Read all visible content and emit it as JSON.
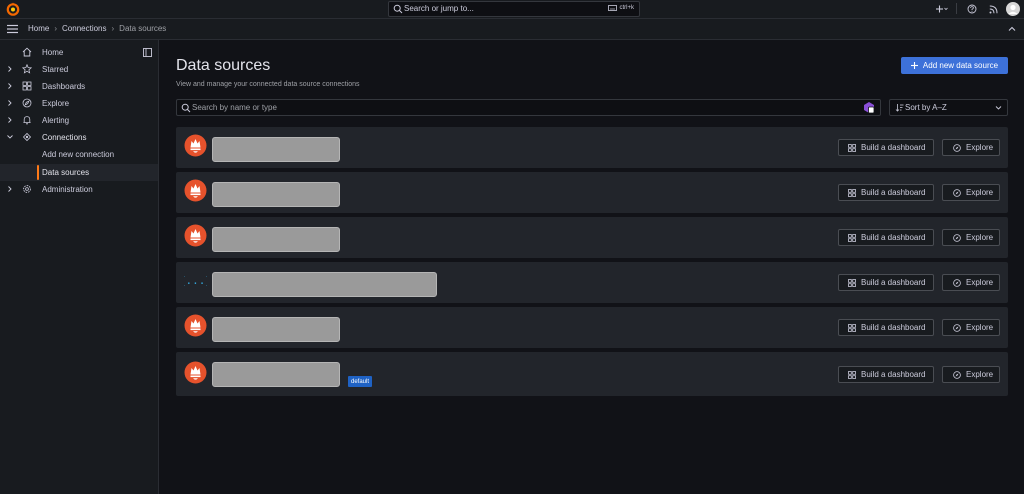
{
  "topbar": {
    "search_placeholder": "Search or jump to...",
    "shortcut": "ctrl+k"
  },
  "breadcrumbs": [
    "Home",
    "Connections",
    "Data sources"
  ],
  "sidebar": {
    "items": [
      {
        "label": "Home"
      },
      {
        "label": "Starred"
      },
      {
        "label": "Dashboards"
      },
      {
        "label": "Explore"
      },
      {
        "label": "Alerting"
      },
      {
        "label": "Connections"
      },
      {
        "label": "Add new connection"
      },
      {
        "label": "Data sources"
      },
      {
        "label": "Administration"
      }
    ]
  },
  "main": {
    "title": "Data sources",
    "subtitle": "View and manage your connected data source connections",
    "add_button": "Add new data source",
    "search_placeholder": "Search by name or type",
    "sort_label": "Sort by A–Z",
    "build_label": "Build a dashboard",
    "explore_label": "Explore",
    "default_badge": "default",
    "datasources": [
      {
        "icon": "prometheus-icon"
      },
      {
        "icon": "prometheus-icon"
      },
      {
        "icon": "prometheus-icon"
      },
      {
        "icon": "json-braces-icon"
      },
      {
        "icon": "prometheus-icon"
      },
      {
        "icon": "prometheus-icon",
        "is_default": true
      }
    ]
  },
  "colors": {
    "accent": "#ff7a18",
    "primary": "#3d71d9",
    "background": "#111217",
    "panel": "#181b1f",
    "row": "#22252b",
    "prometheus": "#e6522c"
  }
}
